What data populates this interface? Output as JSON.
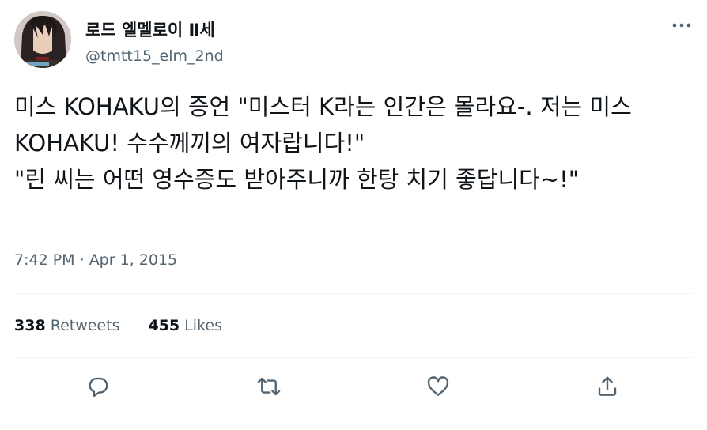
{
  "author": {
    "display_name": "로드 엘멜로이 Ⅱ세",
    "handle": "@tmtt15_elm_2nd"
  },
  "tweet": {
    "text": "미스 KOHAKU의 증언 \"미스터 K라는 인간은 몰라요-. 저는 미스 KOHAKU! 수수께끼의 여자랍니다!\"\n\"린 씨는 어떤 영수증도 받아주니까 한탕 치기 좋답니다~!\"",
    "time": "7:42 PM",
    "separator": " · ",
    "date": "Apr 1, 2015"
  },
  "stats": {
    "retweets_count": "338",
    "retweets_label": "Retweets",
    "likes_count": "455",
    "likes_label": "Likes"
  },
  "icons": {
    "more": "more-horizontal-icon",
    "reply": "reply-icon",
    "retweet": "retweet-icon",
    "like": "heart-icon",
    "share": "share-icon"
  },
  "colors": {
    "text_primary": "#0f1419",
    "text_secondary": "#536471",
    "divider": "#eff3f4"
  }
}
